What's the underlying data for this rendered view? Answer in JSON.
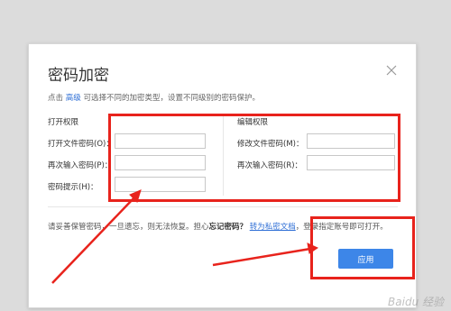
{
  "dialog": {
    "title": "密码加密",
    "hint_prefix": "点击",
    "hint_link": "高级",
    "hint_suffix": "可选择不同的加密类型，设置不同级别的密码保护。"
  },
  "open_permission": {
    "section_title": "打开权限",
    "password_label": "打开文件密码(O)：",
    "confirm_label": "再次输入密码(P)：",
    "hint_label": "密码提示(H)：",
    "password_value": "",
    "confirm_value": "",
    "hint_value": ""
  },
  "edit_permission": {
    "section_title": "编辑权限",
    "password_label": "修改文件密码(M)：",
    "confirm_label": "再次输入密码(R)：",
    "password_value": "",
    "confirm_value": ""
  },
  "note": {
    "text1": "请妥善保管密码，一旦遗忘，则无法恢复。担心",
    "bold": "忘记密码？",
    "link": "转为私密文档",
    "text2": "，登录指定账号即可打开。"
  },
  "apply_label": "应用",
  "watermark": "Baidu 经验",
  "colors": {
    "accent": "#3d86e8",
    "link": "#2f6fd6",
    "highlight": "#e8231c"
  }
}
